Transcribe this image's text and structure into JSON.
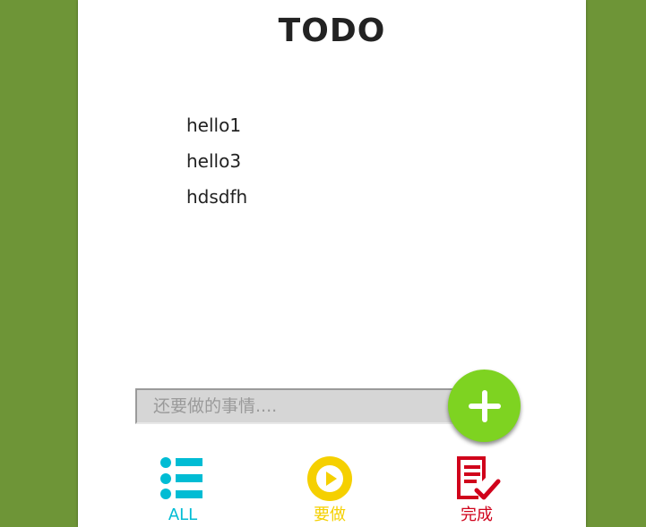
{
  "header": {
    "title": "TODO"
  },
  "todos": [
    {
      "text": "hello1"
    },
    {
      "text": "hello3"
    },
    {
      "text": "hdsdfh"
    }
  ],
  "input": {
    "placeholder": "还要做的事情....",
    "value": ""
  },
  "add_button": {
    "icon": "plus-icon",
    "color": "#7ed321"
  },
  "nav": {
    "all": {
      "label": "ALL",
      "icon": "list-icon",
      "color": "#00bcd4"
    },
    "todo": {
      "label": "要做",
      "icon": "play-icon",
      "color": "#f5d000"
    },
    "done": {
      "label": "完成",
      "icon": "checklist-icon",
      "color": "#d0021b"
    }
  },
  "colors": {
    "background": "#6e9537",
    "panel": "#ffffff"
  }
}
